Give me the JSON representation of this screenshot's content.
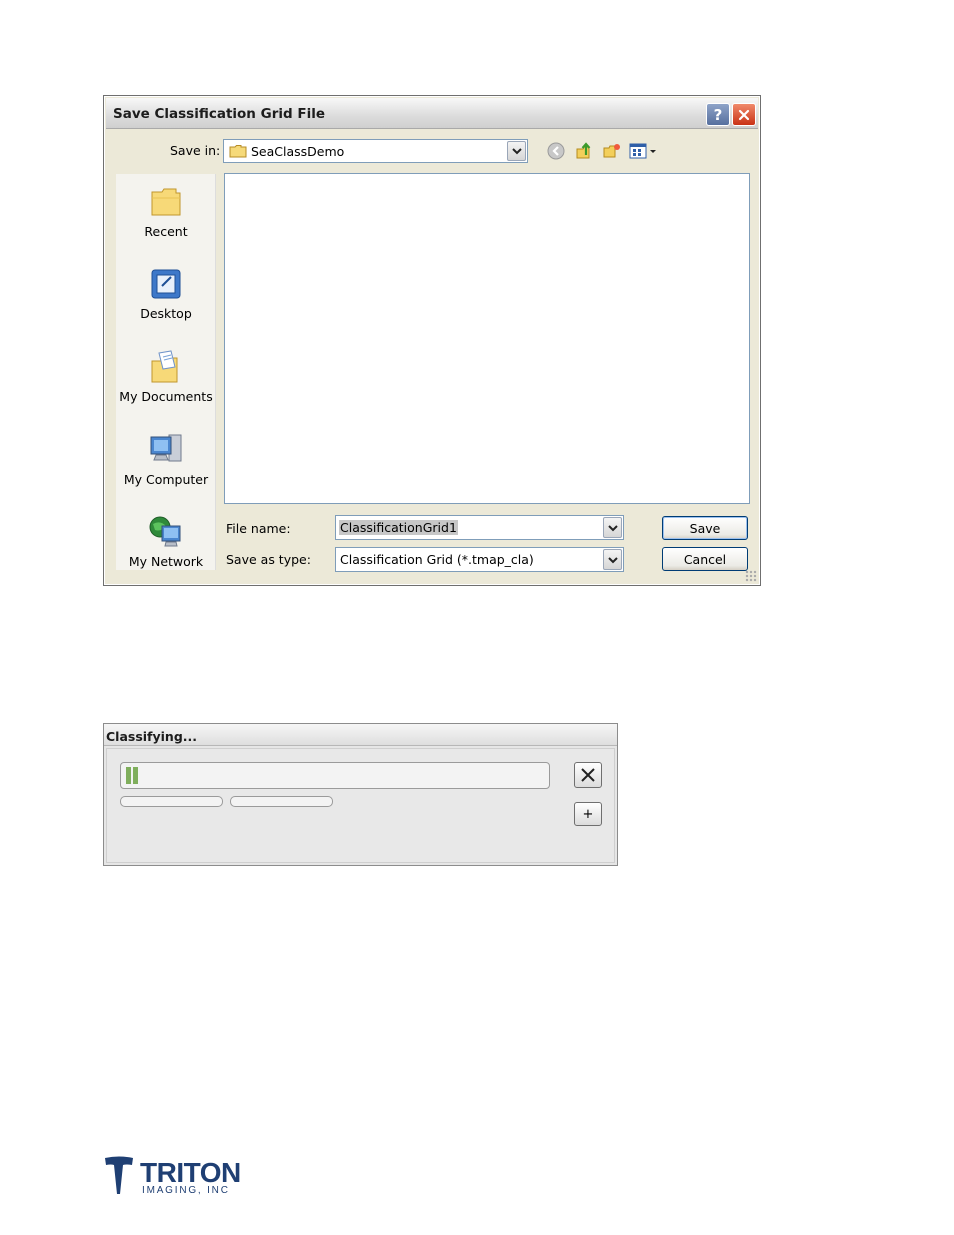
{
  "save_dialog": {
    "title": "Save Classification Grid File",
    "help_label": "?",
    "save_in_label": "Save in:",
    "save_in_value": "SeaClassDemo",
    "places": [
      {
        "label": "Recent",
        "icon": "recent-folder-icon"
      },
      {
        "label": "Desktop",
        "icon": "desktop-icon"
      },
      {
        "label": "My Documents",
        "icon": "my-documents-icon"
      },
      {
        "label": "My Computer",
        "icon": "my-computer-icon"
      },
      {
        "label": "My Network",
        "icon": "my-network-icon"
      }
    ],
    "file_name_label": "File name:",
    "file_name_value": "ClassificationGrid1",
    "save_as_type_label": "Save as type:",
    "save_as_type_value": "Classification Grid (*.tmap_cla)",
    "save_label": "Save",
    "cancel_label": "Cancel"
  },
  "classify_dialog": {
    "title": "Classifying...",
    "expand_label": "+"
  },
  "logo": {
    "name": "TRITON",
    "subtitle": "IMAGING, INC",
    "color": "#1f3f73"
  }
}
